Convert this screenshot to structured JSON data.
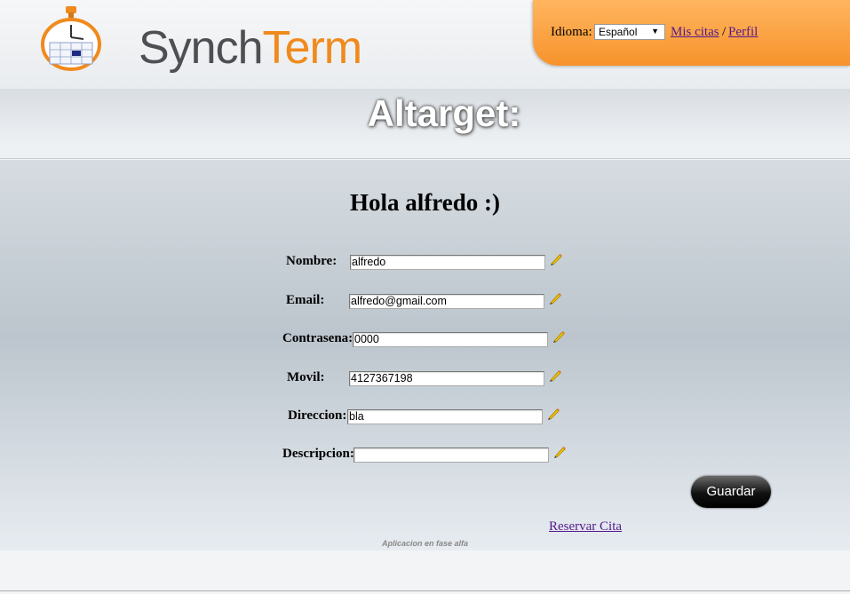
{
  "header": {
    "logo_part1": "Synch",
    "logo_part2": "Term",
    "idioma_label": "Idioma:",
    "language_selected": "Español",
    "mis_citas_link": "Mis citas",
    "separator": "/",
    "perfil_link": "Perfil"
  },
  "site_title": "Altarget:",
  "greeting": "Hola alfredo :)",
  "form": {
    "fields": [
      {
        "label": "Nombre:",
        "value": "alfredo"
      },
      {
        "label": "Email:",
        "value": "alfredo@gmail.com"
      },
      {
        "label": "Contrasena:",
        "value": "0000"
      },
      {
        "label": "Movil:",
        "value": "4127367198"
      },
      {
        "label": "Direccion:",
        "value": "bla"
      },
      {
        "label": "Descripcion:",
        "value": ""
      }
    ],
    "save_label": "Guardar"
  },
  "reservar_link": "Reservar Cita",
  "footer_note": "Aplicacion en fase alfa",
  "colors": {
    "accent_orange": "#f7932c",
    "logo_gray": "#4d4f53",
    "logo_orange": "#f08a1d",
    "link_visited": "#551a8b"
  },
  "icons": [
    "stopwatch-calendar-logo-icon",
    "pencil-edit-icon"
  ]
}
